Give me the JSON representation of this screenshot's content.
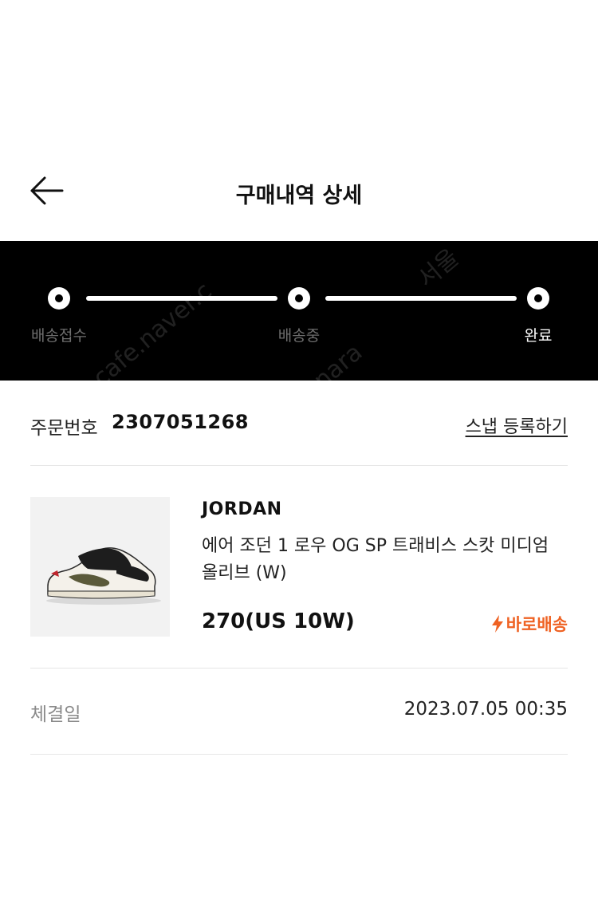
{
  "header": {
    "title": "구매내역 상세",
    "back_icon": "arrow-left-icon"
  },
  "progress": {
    "steps": [
      {
        "label": "배송접수",
        "state": "done"
      },
      {
        "label": "배송중",
        "state": "done"
      },
      {
        "label": "완료",
        "state": "current"
      }
    ],
    "watermarks": [
      "cafe.naver.c",
      "서울",
      "nara"
    ]
  },
  "order": {
    "label": "주문번호",
    "number": "2307051268",
    "snap_link": "스냅 등록하기"
  },
  "product": {
    "brand": "JORDAN",
    "name": "에어 조던 1 로우 OG SP 트래비스 스캇 미디엄 올리브 (W)",
    "size": "270(US 10W)",
    "delivery_badge": "바로배송",
    "delivery_icon": "lightning-icon",
    "accent_color": "#ef6223"
  },
  "deal": {
    "label": "체결일",
    "datetime": "2023.07.05 00:35"
  }
}
